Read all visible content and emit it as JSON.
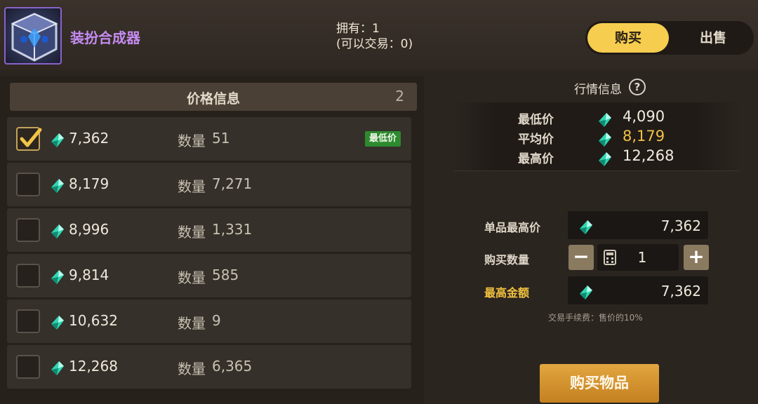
{
  "item": {
    "name": "装扮合成器",
    "owned_line1": "拥有：1",
    "owned_line2": "(可以交易：0)",
    "icon": "cube-icon"
  },
  "tabs": [
    {
      "label": "购买",
      "active": true
    },
    {
      "label": "出售",
      "active": false
    }
  ],
  "price_list": {
    "title": "价格信息",
    "count": "2",
    "qty_label": "数量",
    "lowest_badge": "最低价",
    "rows": [
      {
        "price": "7,362",
        "qty": "51",
        "checked": true,
        "lowest": true
      },
      {
        "price": "8,179",
        "qty": "7,271",
        "checked": false,
        "lowest": false
      },
      {
        "price": "8,996",
        "qty": "1,331",
        "checked": false,
        "lowest": false
      },
      {
        "price": "9,814",
        "qty": "585",
        "checked": false,
        "lowest": false
      },
      {
        "price": "10,632",
        "qty": "9",
        "checked": false,
        "lowest": false
      },
      {
        "price": "12,268",
        "qty": "6,365",
        "checked": false,
        "lowest": false
      }
    ]
  },
  "market": {
    "title": "行情信息",
    "help": "?",
    "rows": [
      {
        "label": "最低价",
        "value": "4,090"
      },
      {
        "label": "平均价",
        "value": "8,179"
      },
      {
        "label": "最高价",
        "value": "12,268"
      }
    ]
  },
  "order": {
    "max_unit_label": "单品最高价",
    "max_unit_value": "7,362",
    "qty_label": "购买数量",
    "qty_value": "1",
    "minus": "−",
    "plus": "+",
    "max_total_label": "最高金额",
    "max_total_value": "7,362",
    "fee_note": "交易手续费：售价的10%",
    "buy_button": "购买物品"
  },
  "colors": {
    "accent_gold": "#f6cd4f",
    "item_purple": "#c58cf2",
    "lowest_green": "#2d8a2f",
    "gem": "#2fd6b0"
  }
}
